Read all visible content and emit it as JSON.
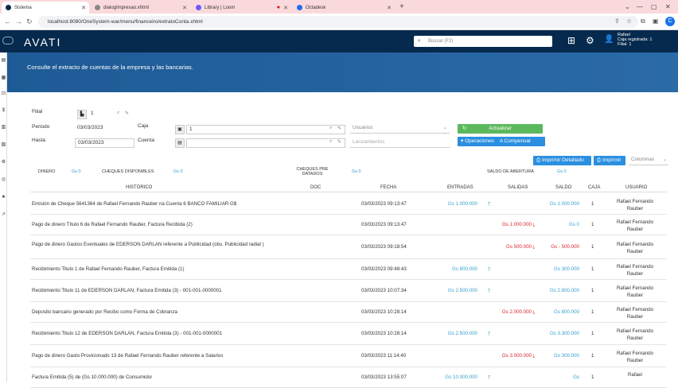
{
  "browser": {
    "tabs": [
      {
        "title": "Sistema",
        "color": "#0a2a4a"
      },
      {
        "title": "dialogImpresao.xhtml",
        "color": "#777"
      },
      {
        "title": "Library | Loom",
        "color": "#6a5cff"
      },
      {
        "title": "Octadesk",
        "color": "#1e6ef0"
      }
    ],
    "url": "localhost:8080/OneSystem-war/menu/financeiro/extratoConta.xhtml",
    "profile_initial": "C"
  },
  "header": {
    "logo": "AVATI",
    "search_placeholder": "Buscar (F2)",
    "user_name": "Rafael",
    "user_caixa": "Caja registrada: 1",
    "user_filial": "Filial: 1"
  },
  "banner": {
    "text": "Consulte el extracto de cuentas de la empresa y las bancarias."
  },
  "filters": {
    "filial_label": "Filial",
    "filial_value": "1",
    "periodo_label": "Periodo",
    "periodo_value": "03/03/2023",
    "hasta_label": "Hasta",
    "hasta_value": "03/03/2023",
    "caja_label": "Caja",
    "caja_value": "1",
    "cuenta_label": "Cuenta",
    "cuenta_value": "",
    "usuarios_placeholder": "Usuarios",
    "lanzamientos_placeholder": "Lanzamientos",
    "actualizar": "Actualizar",
    "operaciones": "Operaciones",
    "a_compensar": "A Compensar",
    "imprimir_detallado": "Imprimir Detallado",
    "imprimir": "Imprimir",
    "columnas": "Columnas"
  },
  "summary": {
    "dinero_label": "DINERO",
    "dinero_value": "Gs 0",
    "cheques_disp_label": "CHEQUES DISPONIBLES",
    "cheques_disp_value": "Gs 0",
    "cheques_pre_label": "CHEQUES PRE DATADOS",
    "cheques_pre_value": "Gs 0",
    "saldo_abertura_label": "SALDO DE ABERTURA",
    "saldo_abertura_value": "Gs 0"
  },
  "table": {
    "columns": [
      "HISTÓRICO",
      "DOC",
      "FECHA",
      "ENTRADAS",
      "SALIDAS",
      "SALDO",
      "CAJA",
      "USUARIO"
    ],
    "rows": [
      {
        "hist": "Emisión de Cheque 5641364 de Rafael Fernando Rauber na Cuenta 6 BANCO FAMILIAR G$",
        "fecha": "03/03/2023 09:13:47",
        "entrada": "Gs 1.000.000",
        "salida": "",
        "saldo": "Gs 1.000.000",
        "caja": "1",
        "usuario": "Rafael Fernando Rauber",
        "dir": "up"
      },
      {
        "hist": "Pago de dinero Título 6 de Rafael Fernando Rauber, Factura Recibida (2)",
        "fecha": "03/03/2023 09:13:47",
        "entrada": "",
        "salida": "Gs 1.000.000",
        "saldo": "Gs 0",
        "caja": "1",
        "usuario": "Rafael Fernando Rauber",
        "dir": "down"
      },
      {
        "hist": "Pago de dinero Gastos Eventuales de EDERSON DARLAN referente a Publicidad (obs. Publicidad radial )",
        "fecha": "03/03/2023 09:18:54",
        "entrada": "",
        "salida": "Gs 500.000",
        "saldo": "Gs - 500.000",
        "caja": "1",
        "usuario": "Rafael Fernando Rauber",
        "dir": "down"
      },
      {
        "hist": "Recibimiento Titulo 1 de Rafael Fernando Rauber, Factura Emitida (1)",
        "fecha": "03/03/2023 09:48:43",
        "entrada": "Gs 800.000",
        "salida": "",
        "saldo": "Gs 300.000",
        "caja": "1",
        "usuario": "Rafael Fernando Rauber",
        "dir": "up"
      },
      {
        "hist": "Recibimiento Titulo 11 de EDERSON DARLAN, Factura Emitida (3) - 001-001-0000001",
        "fecha": "03/03/2023 10:07:34",
        "entrada": "Gs 2.500.000",
        "salida": "",
        "saldo": "Gs 2.800.000",
        "caja": "1",
        "usuario": "Rafael Fernando Rauber",
        "dir": "up"
      },
      {
        "hist": "Deposito bancario generado por Recibo como Forma de Cobranza",
        "fecha": "03/03/2023 10:28:14",
        "entrada": "",
        "salida": "Gs 2.000.000",
        "saldo": "Gs 800.000",
        "caja": "1",
        "usuario": "Rafael Fernando Rauber",
        "dir": "down"
      },
      {
        "hist": "Recibimiento Titulo 12 de EDERSON DARLAN, Factura Emitida (3) - 001-001-0000001",
        "fecha": "03/03/2023 10:28:14",
        "entrada": "Gs 2.500.000",
        "salida": "",
        "saldo": "Gs 3.300.000",
        "caja": "1",
        "usuario": "Rafael Fernando Rauber",
        "dir": "up"
      },
      {
        "hist": "Pago de dinero Gasto Provicionado 13 de Rafael Fernando Rauber referente a Salarios",
        "fecha": "03/03/2023 11:14:40",
        "entrada": "",
        "salida": "Gs 3.000.000",
        "saldo": "Gs 300.000",
        "caja": "1",
        "usuario": "Rafael Fernando Rauber",
        "dir": "down"
      },
      {
        "hist": "Factura Emitida (5) de (Gs 10.000.000) de Consumidor",
        "fecha": "03/03/2023 13:55:07",
        "entrada": "Gs 10.000.000",
        "salida": "",
        "saldo": "Gs",
        "caja": "1",
        "usuario": "Rafael",
        "dir": "up"
      }
    ]
  }
}
